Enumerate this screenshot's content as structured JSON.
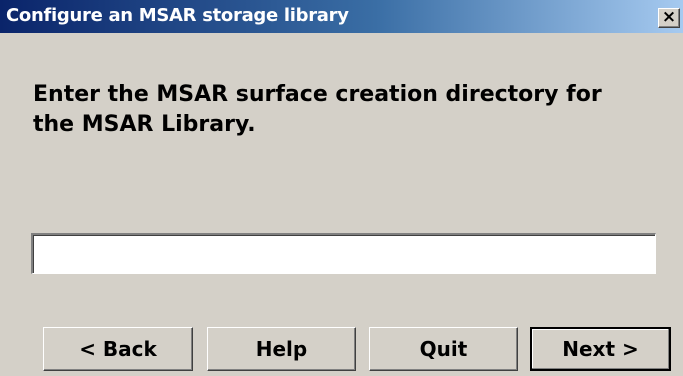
{
  "window": {
    "title": "Configure an MSAR storage library",
    "close_label": "×"
  },
  "prompt": {
    "text": "Enter the MSAR surface creation directory for the MSAR Library."
  },
  "directory_field": {
    "value": "",
    "placeholder": ""
  },
  "buttons": {
    "back": "< Back",
    "help": "Help",
    "quit": "Quit",
    "next": "Next >"
  },
  "colors": {
    "face": "#d4d0c8",
    "titlebar_start": "#0a246a",
    "titlebar_end": "#a6caf0"
  }
}
